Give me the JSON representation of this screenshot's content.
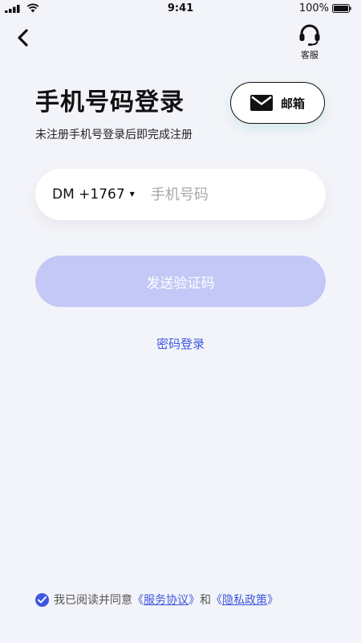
{
  "status_bar": {
    "time": "9:41",
    "battery": "100%"
  },
  "header": {
    "service_label": "客服"
  },
  "login": {
    "title": "手机号码登录",
    "subtitle": "未注册手机号登录后即完成注册",
    "email_button": "邮箱",
    "country_code": "DM +1767",
    "phone_placeholder": "手机号码",
    "phone_value": "",
    "send_code_button": "发送验证码",
    "password_login_link": "密码登录"
  },
  "agreement": {
    "checked": true,
    "prefix": "我已阅读并同意",
    "terms_open": "《",
    "terms_text": "服务协议",
    "terms_close": "》",
    "and": "和",
    "privacy_open": "《",
    "privacy_text": "隐私政策",
    "privacy_close": "》"
  },
  "colors": {
    "accent": "#3d57e0",
    "disabled_button": "#c3c8f7",
    "background": "#f3f4f9"
  },
  "icons": [
    "signal-icon",
    "wifi-icon",
    "battery-icon",
    "back-arrow-icon",
    "headset-icon",
    "mail-icon",
    "caret-down-icon",
    "check-icon"
  ]
}
